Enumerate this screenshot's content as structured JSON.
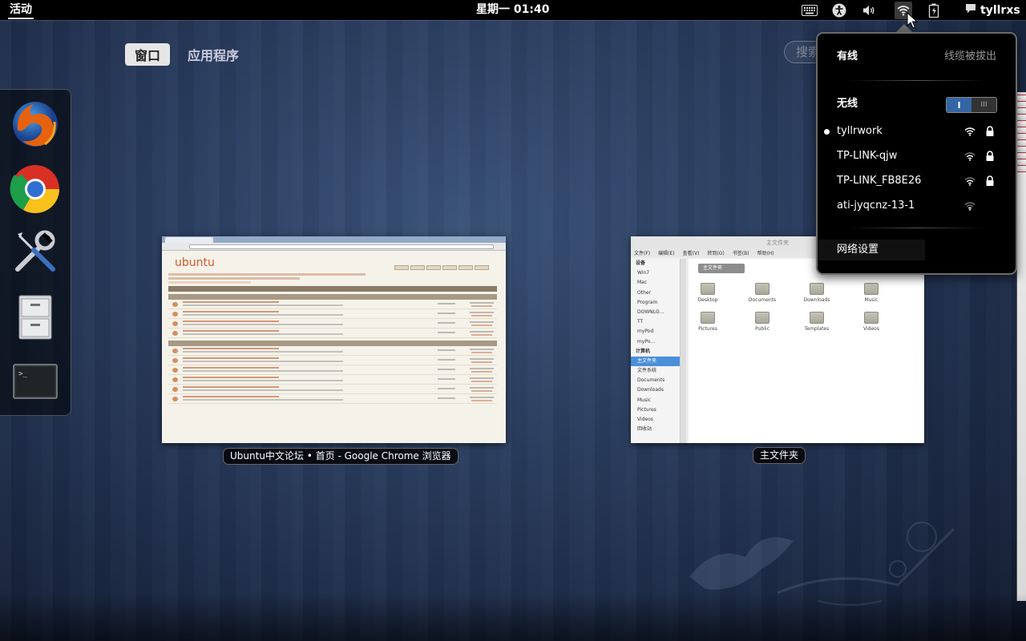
{
  "topbar": {
    "activities_label": "活动",
    "clock": "星期一 01:40",
    "username": "tyllrxs",
    "tray_icons": [
      "keyboard-icon",
      "accessibility-icon",
      "volume-icon",
      "wifi-icon",
      "battery-icon",
      "chat-icon"
    ]
  },
  "overview": {
    "tabs": [
      {
        "label": "窗口",
        "active": true
      },
      {
        "label": "应用程序",
        "active": false
      }
    ],
    "search_placeholder": "搜索"
  },
  "dash": {
    "items": [
      {
        "name": "firefox-icon"
      },
      {
        "name": "chrome-icon"
      },
      {
        "name": "tools-icon"
      },
      {
        "name": "file-cabinet-icon"
      },
      {
        "name": "terminal-icon"
      }
    ]
  },
  "windows": [
    {
      "caption": "Ubuntu中文论坛 • 首页 - Google Chrome 浏览器",
      "logo": "ubuntu"
    },
    {
      "caption": "主文件夹",
      "title": "主文件夹",
      "menu": [
        "文件(F)",
        "编辑(E)",
        "查看(V)",
        "转到(G)",
        "书签(B)",
        "帮助(H)"
      ],
      "sidebar_devices_header": "设备",
      "sidebar_devices": [
        "Win7",
        "Mac",
        "Other",
        "Program",
        "DOWNLO…",
        "TT",
        "myPod",
        "myPo…"
      ],
      "sidebar_computer_header": "计算机",
      "sidebar_computer": [
        "主文件夹",
        "文件系统",
        "Documents",
        "Downloads",
        "Music",
        "Pictures",
        "Videos",
        "回收站"
      ],
      "breadcrumb": "主文件夹",
      "folders": [
        "Desktop",
        "Documents",
        "Downloads",
        "Music",
        "Pictures",
        "Public",
        "Templates",
        "Videos"
      ]
    }
  ],
  "network_menu": {
    "wired_label": "有线",
    "wired_status": "线缆被拔出",
    "wireless_label": "无线",
    "wireless_toggle_on": "I",
    "wireless_toggle_off": "III",
    "networks": [
      {
        "ssid": "tyllrwork",
        "connected": true,
        "secured": true
      },
      {
        "ssid": "TP-LINK-qjw",
        "connected": false,
        "secured": true
      },
      {
        "ssid": "TP-LINK_FB8E26",
        "connected": false,
        "secured": true
      },
      {
        "ssid": "ati-jyqcnz-13-1",
        "connected": false,
        "secured": false
      }
    ],
    "settings_label": "网络设置"
  }
}
